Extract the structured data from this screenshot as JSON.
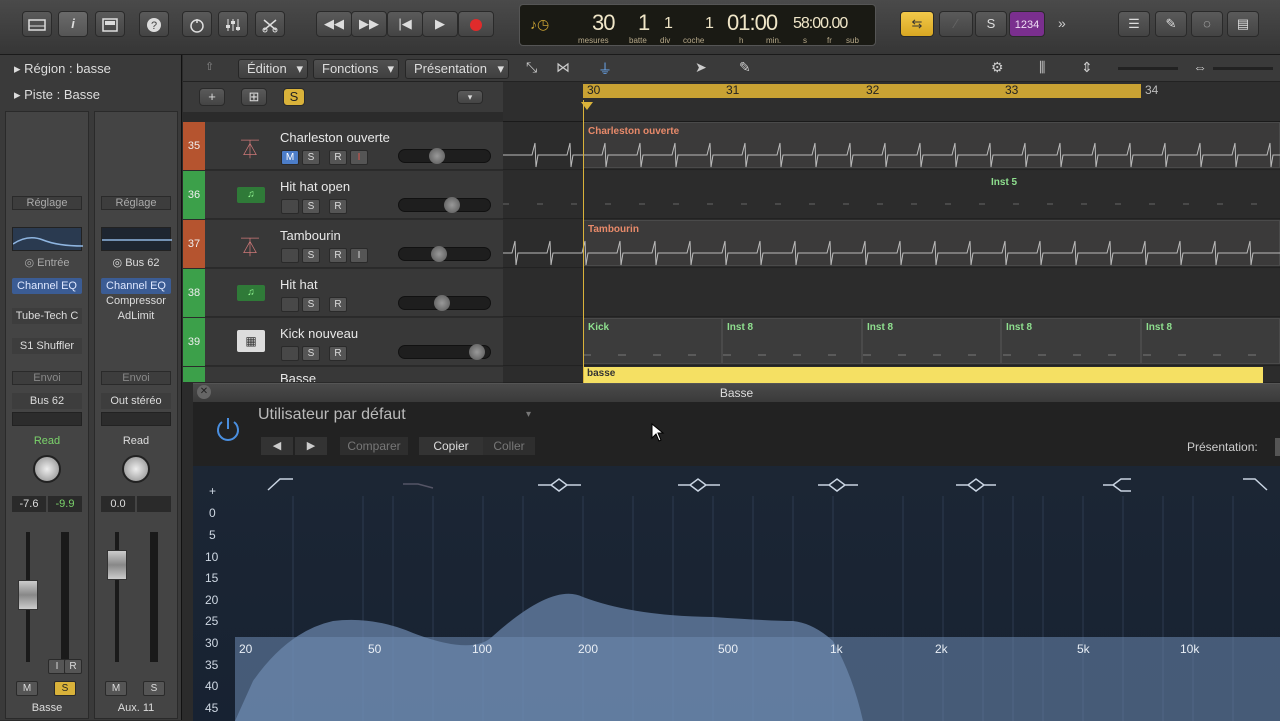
{
  "lcd": {
    "mesures": "30",
    "batte": "1",
    "div": "1",
    "coche": "1",
    "time_h": "01:00",
    "time_rest": "58:00.00",
    "labels": [
      "mesures",
      "batte",
      "div",
      "coche",
      "h",
      "min.",
      "s",
      "fr",
      "sub"
    ]
  },
  "counter": "1234",
  "menus": {
    "edition": "Édition",
    "fonctions": "Fonctions",
    "presentation": "Présentation"
  },
  "inspector": {
    "region": "Région : basse",
    "piste": "Piste : Basse",
    "strips": [
      {
        "setting": "Réglage",
        "input": "Entrée",
        "fx": [
          "Channel EQ",
          "Tube-Tech C",
          "S1 Shuffler"
        ],
        "send": "Envoi",
        "output": "Bus 62",
        "mode": "Read",
        "vol": "-7.6",
        "peak": "-9.9",
        "name": "Basse",
        "ms": [
          "M",
          "S"
        ],
        "ir": [
          "I",
          "R"
        ]
      },
      {
        "setting": "Réglage",
        "input": "Bus 62",
        "fx": [
          "Channel EQ",
          "Compressor",
          "AdLimit"
        ],
        "send": "Envoi",
        "output": "Out stéréo",
        "mode": "Read",
        "vol": "0.0",
        "peak": "",
        "name": "Aux. 11",
        "ms": [
          "M",
          "S"
        ]
      }
    ]
  },
  "ruler": [
    "30",
    "31",
    "32",
    "33",
    "34"
  ],
  "tracks": [
    {
      "num": "35",
      "name": "Charleston ouverte",
      "color": "#b5542f",
      "buttons": [
        "M",
        "S",
        "R",
        "I"
      ],
      "region": "Charleston ouverte",
      "vol": 0.4
    },
    {
      "num": "36",
      "name": "Hit hat open",
      "color": "#3ca04a",
      "buttons": [
        "S",
        "R"
      ],
      "region": "Inst 5",
      "vol": 0.55
    },
    {
      "num": "37",
      "name": "Tambourin",
      "color": "#b5542f",
      "buttons": [
        "S",
        "R",
        "I"
      ],
      "region": "Tambourin",
      "vol": 0.42
    },
    {
      "num": "38",
      "name": "Hit hat",
      "color": "#3ca04a",
      "buttons": [
        "S",
        "R"
      ],
      "region": "",
      "vol": 0.46
    },
    {
      "num": "39",
      "name": "Kick nouveau",
      "color": "#3ca04a",
      "buttons": [
        "S",
        "R"
      ],
      "regions": [
        "Kick",
        "Inst 8",
        "Inst 8",
        "Inst 8",
        "Inst 8"
      ],
      "vol": 0.85
    }
  ],
  "partial_track": {
    "name": "Basse",
    "region": "basse"
  },
  "eq": {
    "title": "Basse",
    "preset": "Utilisateur par défaut",
    "compare": "Comparer",
    "copy": "Copier",
    "paste": "Coller",
    "view_label": "Présentation:",
    "db_labels": [
      "+",
      "0",
      "5",
      "10",
      "15",
      "20",
      "25",
      "30",
      "35",
      "40",
      "45"
    ],
    "freq_labels": [
      "20",
      "50",
      "100",
      "200",
      "500",
      "1k",
      "2k",
      "5k",
      "10k"
    ]
  }
}
